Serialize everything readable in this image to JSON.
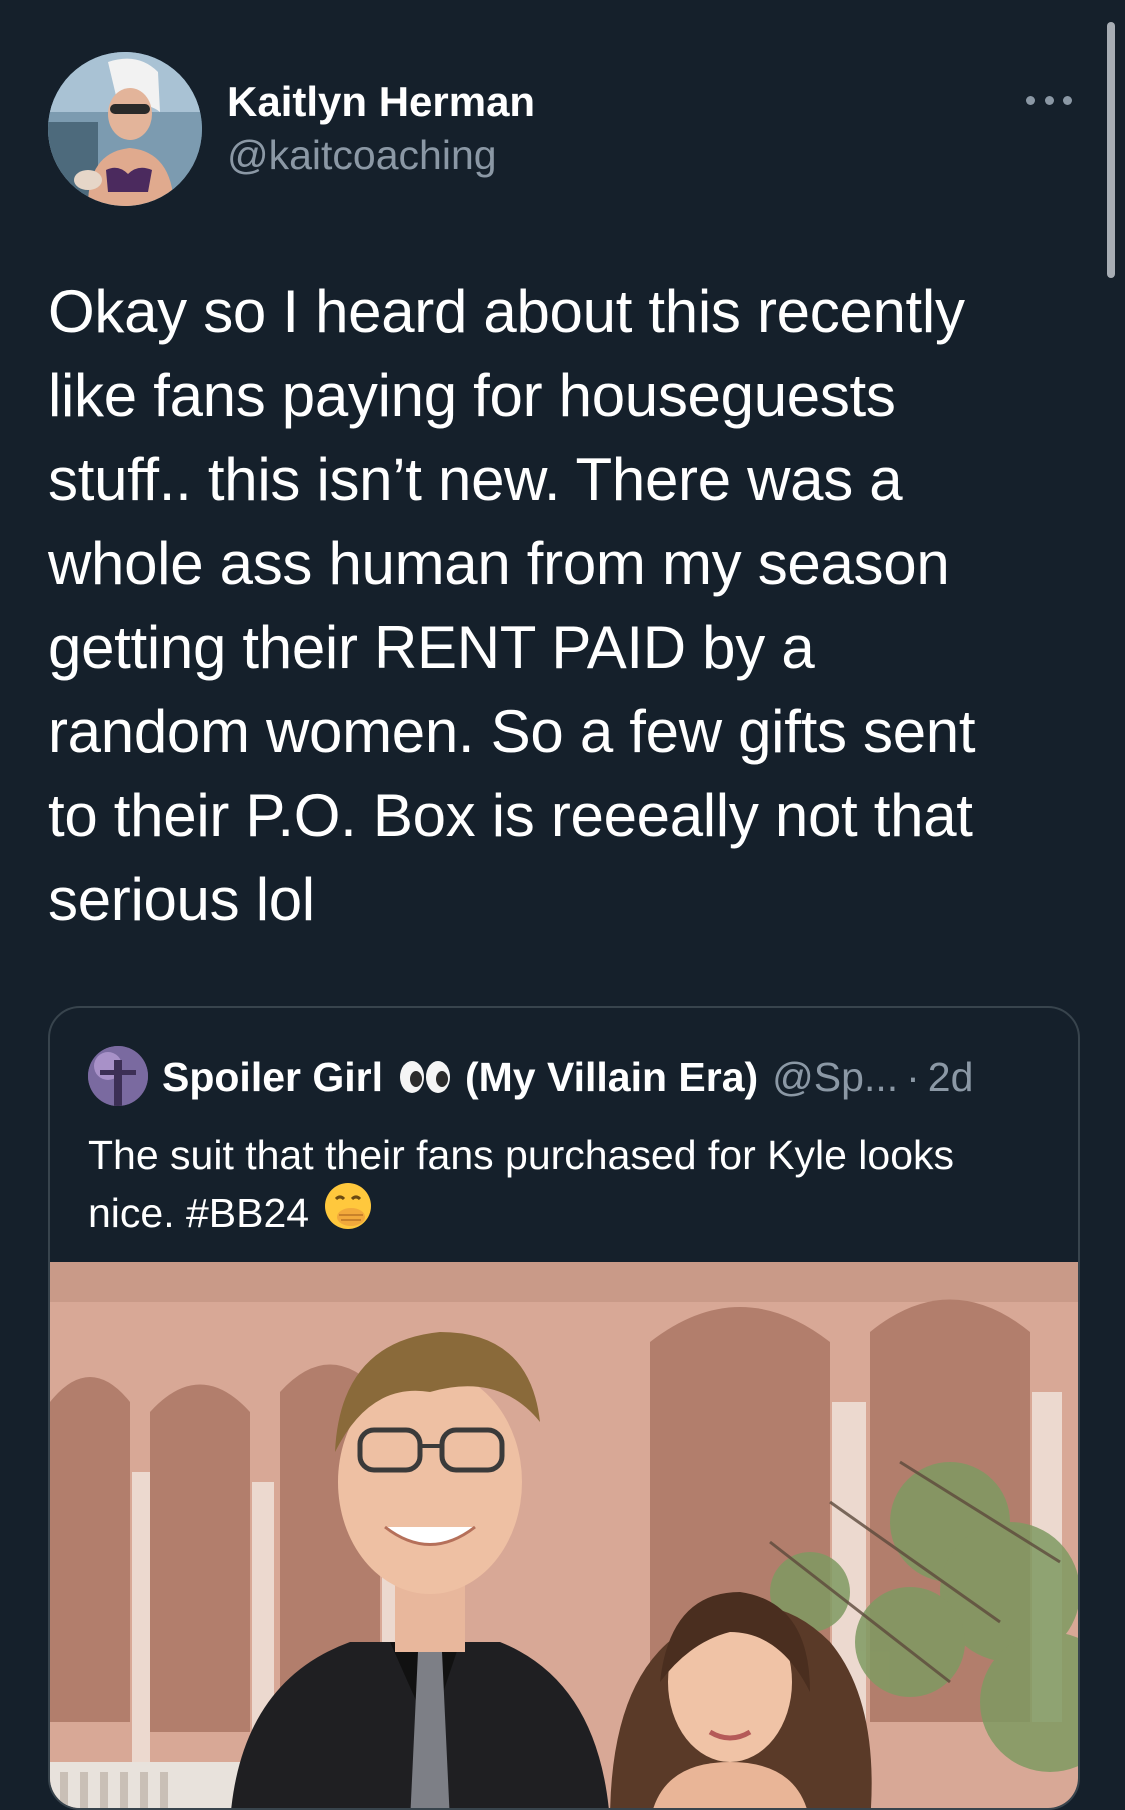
{
  "tweet": {
    "author_name": "Kaitlyn Herman",
    "author_handle": "@kaitcoaching",
    "text": "Okay so I heard about this recently\nlike fans paying for houseguests\nstuff.. this isn’t new. There was a\nwhole ass human from my season\ngetting their RENT PAID by a\nrandom women. So a few gifts sent\nto their P.O. Box is reeeally not that\nserious lol",
    "more_icon": "more-horizontal-icon"
  },
  "quote": {
    "author_name": "Spoiler Girl",
    "eyes_emoji": "eyes-emoji-icon",
    "author_name_suffix": "(My Villain Era)",
    "author_handle": "@Sp...",
    "separator": "·",
    "time": "2d",
    "text": "The suit that their fans purchased for Kyle looks nice. #BB24",
    "emoji": "face-with-hand-over-mouth-icon",
    "photo": "photo-man-and-woman-formal-wear-arcade"
  },
  "colors": {
    "background": "#15202b",
    "primary_text": "#ffffff",
    "secondary_text": "#8b98a5",
    "border": "#38444d"
  }
}
